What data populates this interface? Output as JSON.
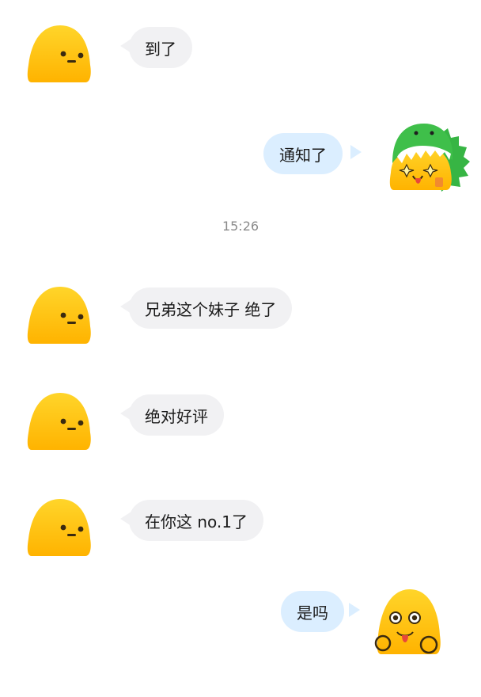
{
  "chat": {
    "messages": [
      {
        "side": "in",
        "text": "到了"
      },
      {
        "side": "out",
        "text": "通知了"
      },
      {
        "side": "in",
        "text": "兄弟这个妹子 绝了"
      },
      {
        "side": "in",
        "text": "绝对好评"
      },
      {
        "side": "in",
        "text": "在你这 no.1了"
      },
      {
        "side": "out",
        "text": "是吗"
      }
    ],
    "timestamp": "15:26"
  },
  "avatars": {
    "contact": "yellow-blob-avatar-icon",
    "self_1": "dinosaur-hood-avatar-icon",
    "self_2": "surprised-blob-avatar-icon"
  },
  "colors": {
    "incoming_bubble": "#f1f1f3",
    "outgoing_bubble": "#dbeeff",
    "avatar_yellow": "#ffc21a",
    "dino_green": "#3fbf4a",
    "timestamp": "#8a8a8a"
  }
}
